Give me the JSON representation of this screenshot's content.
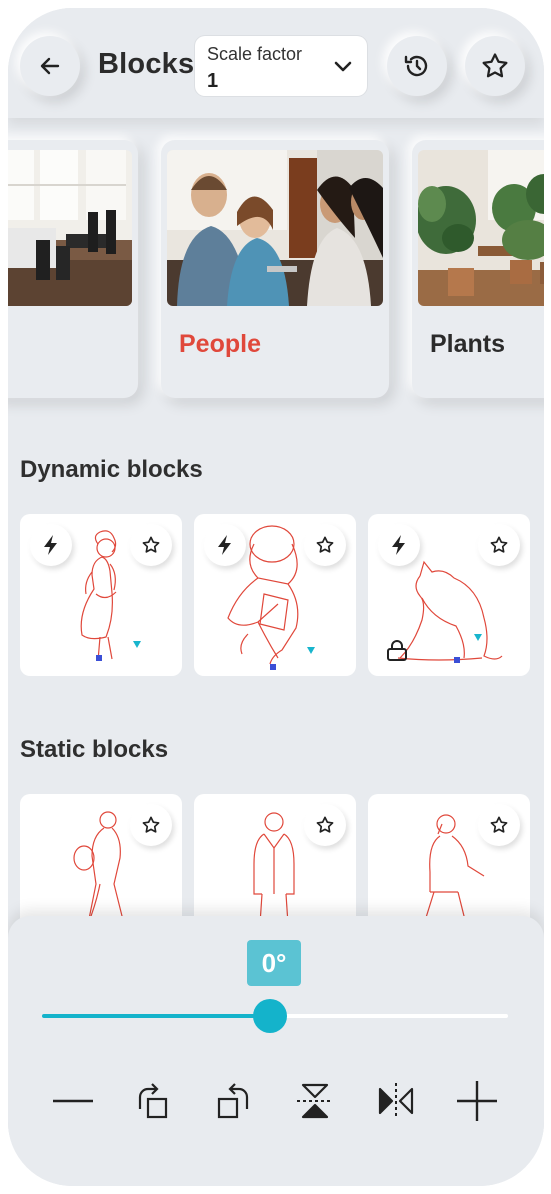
{
  "header": {
    "title": "Blocks",
    "scale_label": "Scale factor",
    "scale_value": "1",
    "back_icon": "arrow-left-icon",
    "history_icon": "history-icon",
    "favorite_icon": "star-icon"
  },
  "categories": [
    {
      "label": "",
      "image": "office-photo"
    },
    {
      "label": "People",
      "image": "people-photo",
      "selected": true,
      "color": "#e0483b"
    },
    {
      "label": "Plants",
      "image": "plants-photo"
    }
  ],
  "dynamic_section": {
    "title": "Dynamic blocks",
    "items": [
      {
        "figure": "woman-walking",
        "dynamic": true
      },
      {
        "figure": "seated-person-top-view",
        "dynamic": true
      },
      {
        "figure": "cat",
        "dynamic": true,
        "locked": true
      }
    ]
  },
  "static_section": {
    "title": "Static blocks",
    "items": [
      {
        "figure": "person-with-bag"
      },
      {
        "figure": "man-in-suit"
      },
      {
        "figure": "person-on-phone"
      }
    ]
  },
  "rotation": {
    "angle_text": "0°",
    "slider_fraction": 0.49
  },
  "toolbar": [
    "minus-icon",
    "rotate-right-icon",
    "rotate-left-icon",
    "flip-vertical-icon",
    "flip-horizontal-icon",
    "plus-icon"
  ],
  "colors": {
    "accent": "#14b3cb",
    "badge": "#5bc3d3",
    "selected_label": "#e0483b",
    "drawing": "#e0483b",
    "background": "#e8ebef"
  }
}
